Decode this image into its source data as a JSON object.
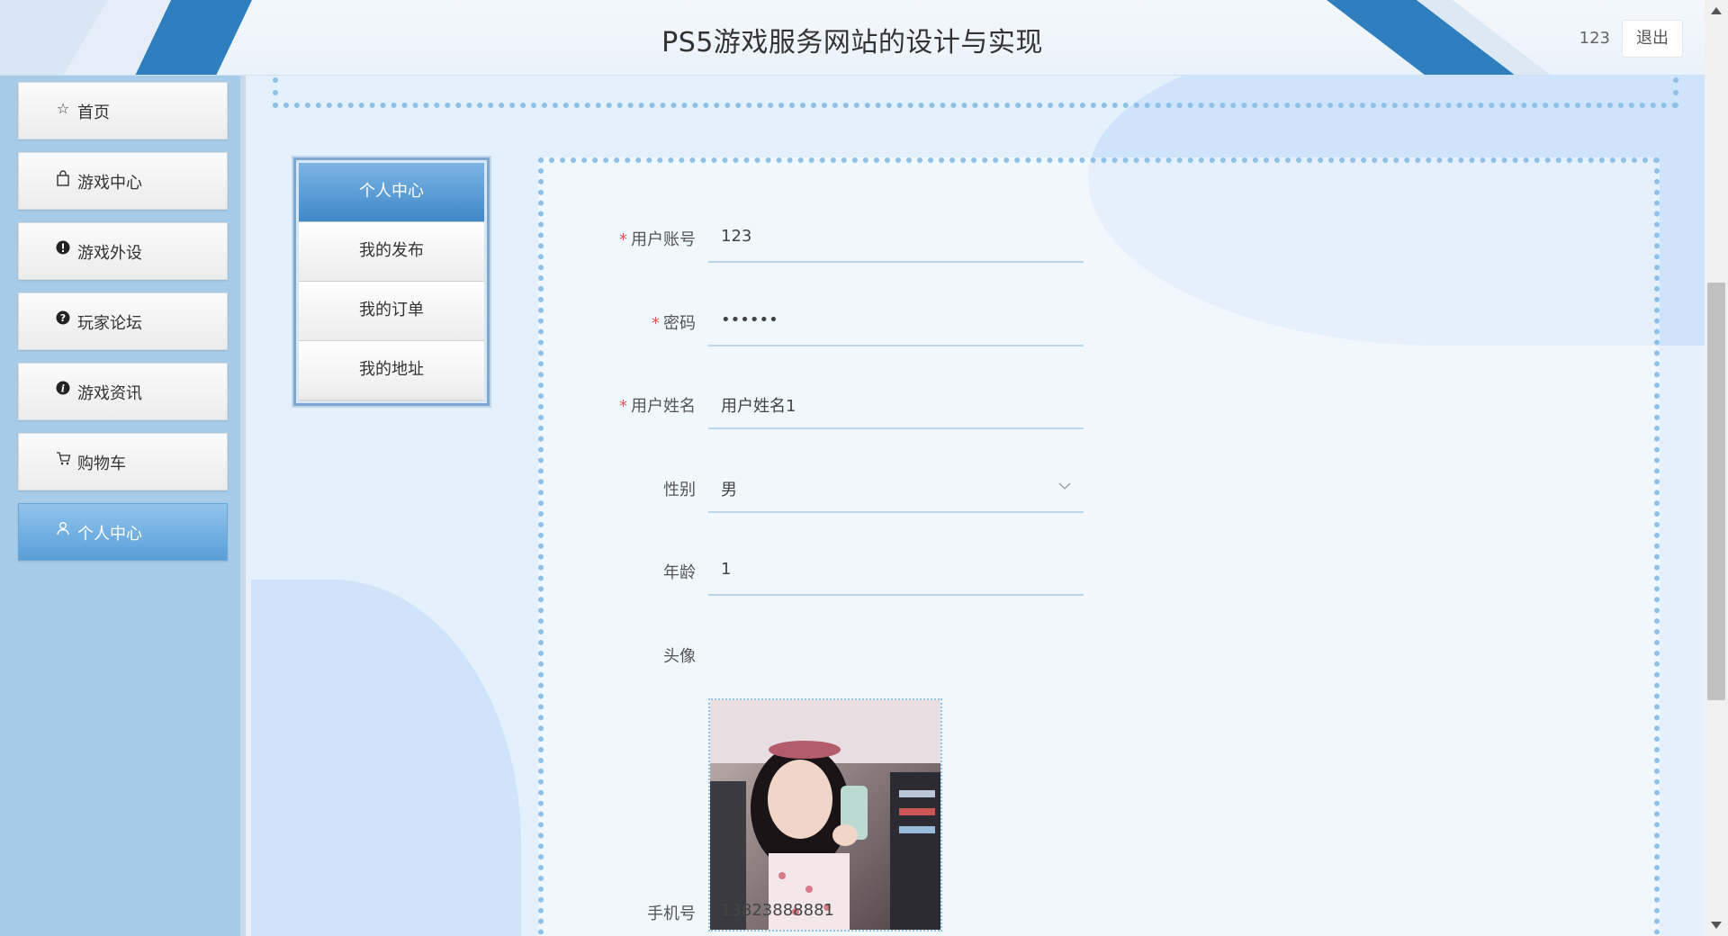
{
  "header": {
    "title": "PS5游戏服务网站的设计与实现",
    "username": "123",
    "logout_label": "退出"
  },
  "sidebar": {
    "items": [
      {
        "label": "首页",
        "icon": "star-icon"
      },
      {
        "label": "游戏中心",
        "icon": "bag-icon"
      },
      {
        "label": "游戏外设",
        "icon": "exclamation-icon"
      },
      {
        "label": "玩家论坛",
        "icon": "question-icon"
      },
      {
        "label": "游戏资讯",
        "icon": "info-icon"
      },
      {
        "label": "购物车",
        "icon": "cart-icon"
      },
      {
        "label": "个人中心",
        "icon": "user-icon",
        "active": true
      }
    ]
  },
  "submenu": {
    "items": [
      "个人中心",
      "我的发布",
      "我的订单",
      "我的地址"
    ],
    "active_index": 0
  },
  "form": {
    "account": {
      "label": "用户账号",
      "value": "123",
      "required": true
    },
    "password": {
      "label": "密码",
      "value": "••••••",
      "required": true
    },
    "name": {
      "label": "用户姓名",
      "value": "用户姓名1",
      "required": true
    },
    "gender": {
      "label": "性别",
      "value": "男"
    },
    "age": {
      "label": "年龄",
      "value": "1"
    },
    "avatar": {
      "label": "头像"
    },
    "phone": {
      "label": "手机号",
      "value": "13823888881"
    }
  },
  "colors": {
    "accent": "#4a90d0",
    "sidebar_bg": "#a6cce9",
    "required": "#e25555"
  }
}
